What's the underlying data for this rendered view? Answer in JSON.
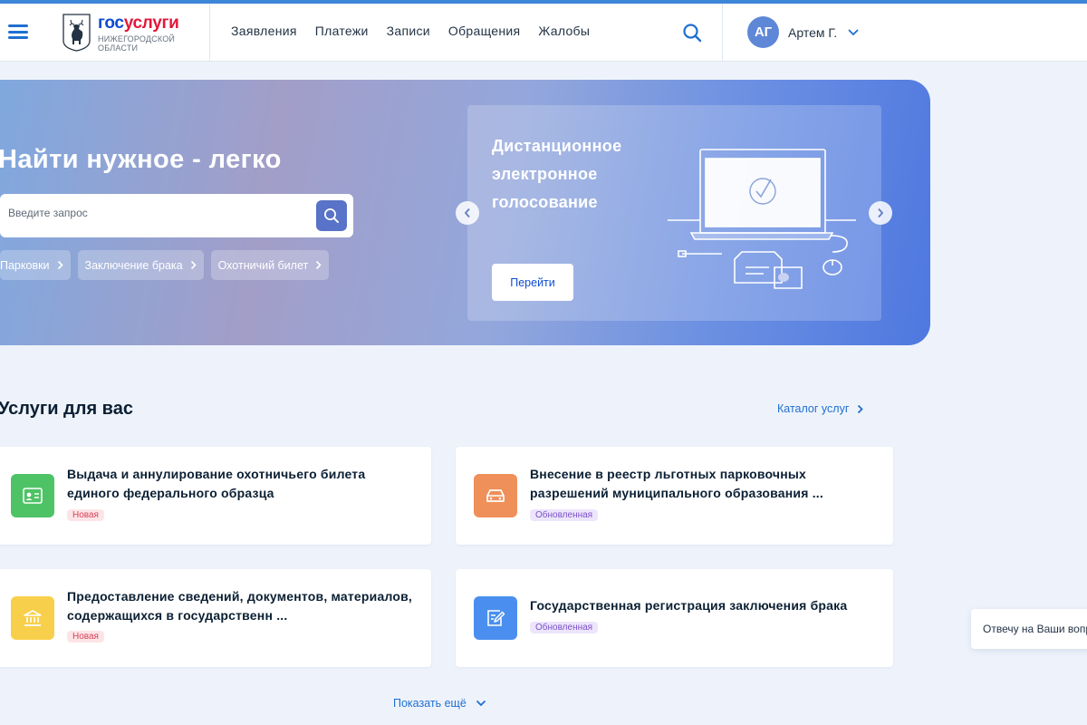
{
  "header": {
    "brand_part1": "гос",
    "brand_part2": "услуги",
    "region_line1": "Нижегородской",
    "region_line2": "области",
    "nav": [
      "Заявления",
      "Платежи",
      "Записи",
      "Обращения",
      "Жалобы"
    ],
    "user_initials": "АГ",
    "user_name": "Артем Г."
  },
  "hero": {
    "title": "Найти нужное - легко",
    "search_placeholder": "Введите запрос",
    "chips": [
      "Парковки",
      "Заключение брака",
      "Охотничий билет"
    ],
    "card_title": "Дистанционное электронное голосование",
    "card_button": "Перейти"
  },
  "services": {
    "title": "Услуги для вас",
    "catalog_link": "Каталог услуг",
    "items": [
      {
        "title": "Выдача и аннулирование охотничьего билета единого федерального образца",
        "badge": "Новая",
        "icon": "id-card-icon",
        "color": "#4dc365"
      },
      {
        "title": "Внесение в реестр льготных парковочных разрешений муниципального образования ...",
        "badge": "Обновленная",
        "icon": "car-icon",
        "color": "#ef8f5a"
      },
      {
        "title": "Предоставление сведений, документов, материалов, содержащихся в государственн ...",
        "badge": "Новая",
        "icon": "building-icon",
        "color": "#f8cf4a"
      },
      {
        "title": "Государственная регистрация заключения брака",
        "badge": "Обновленная",
        "icon": "edit-document-icon",
        "color": "#4a8ff0"
      }
    ],
    "show_more": "Показать ещё"
  },
  "chat_widget": "Отвечу на Ваши вопросы",
  "colors": {
    "accent": "#1f6fd0",
    "brand_blue": "#0d4cd3",
    "brand_red": "#e3173a"
  }
}
